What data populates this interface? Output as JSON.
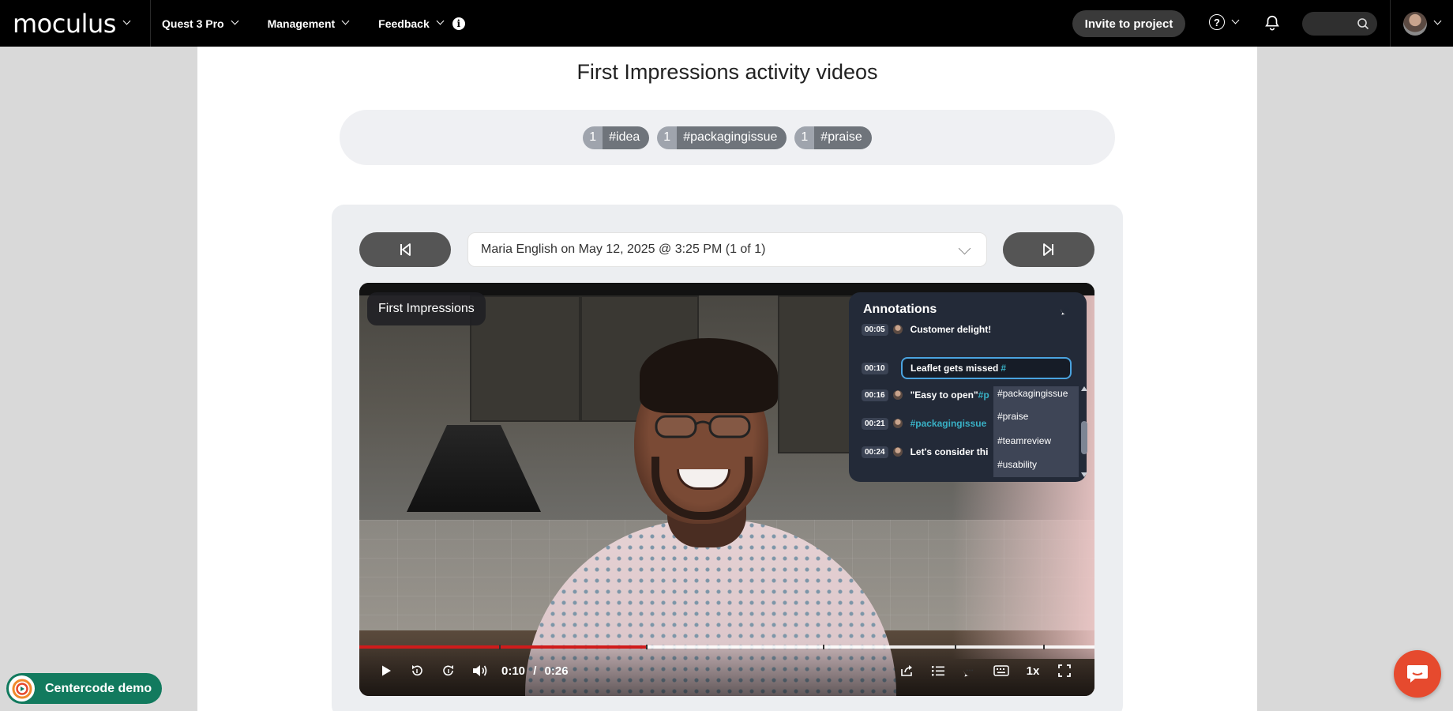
{
  "app": {
    "brand": "moculus"
  },
  "nav": [
    {
      "label": "Quest 3 Pro"
    },
    {
      "label": "Management"
    },
    {
      "label": "Feedback"
    }
  ],
  "header": {
    "invite_label": "Invite to project",
    "help_label": "?"
  },
  "page": {
    "title": "First Impressions activity videos"
  },
  "tags": [
    {
      "count": "1",
      "label": "#idea"
    },
    {
      "count": "1",
      "label": "#packagingissue"
    },
    {
      "count": "1",
      "label": "#praise"
    }
  ],
  "session": {
    "selected": "Maria English on May 12, 2025 @ 3:25 PM (1 of 1)"
  },
  "video": {
    "label": "First Impressions",
    "current_time": "0:10",
    "separator": "/",
    "duration": "0:26",
    "progress_fraction": 0.39,
    "markers": [
      0.19,
      0.39,
      0.63,
      0.81,
      0.93
    ],
    "rate": "1x"
  },
  "annotations": {
    "title": "Annotations",
    "items": [
      {
        "time": "00:05",
        "text": "Customer delight!",
        "tag": ""
      },
      {
        "time": "00:16",
        "text": "\"Easy to open\" ",
        "tag": "#p"
      },
      {
        "time": "00:21",
        "text": "",
        "tag": "#packagingissue"
      },
      {
        "time": "00:24",
        "text": "Let's consider thi",
        "tag": ""
      }
    ],
    "editing": {
      "time": "00:10",
      "text": "Leaflet gets missed",
      "tag": "#"
    },
    "suggestions": [
      "#packagingissue",
      "#praise",
      "#teamreview",
      "#usability"
    ]
  },
  "footer": {
    "demo_label": "Centercode demo"
  },
  "colors": {
    "accent_red": "#d01b1b",
    "hashtag": "#39b0c5",
    "demo_green": "#127a5e",
    "chat_orange": "#e64a2e"
  }
}
